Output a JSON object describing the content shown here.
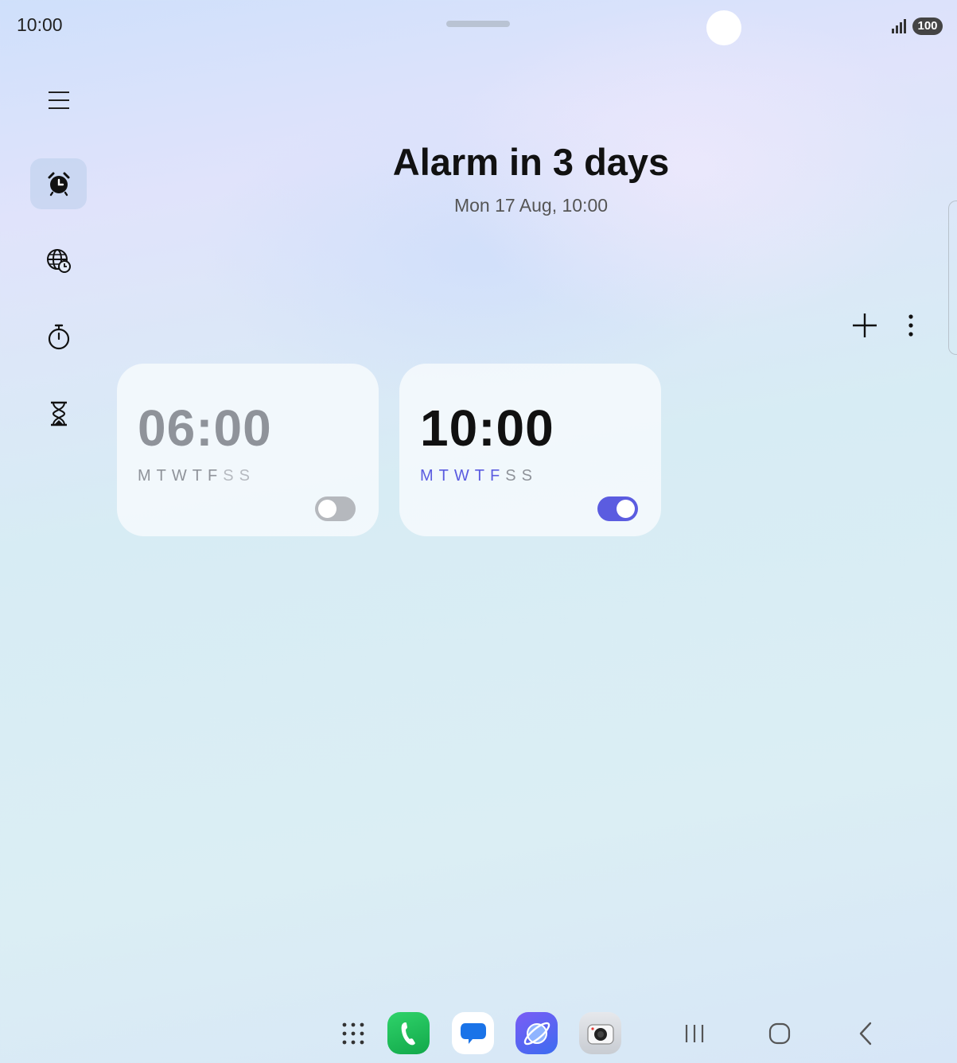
{
  "status_bar": {
    "time": "10:00",
    "battery": "100"
  },
  "header": {
    "title": "Alarm in 3 days",
    "subtitle": "Mon 17 Aug, 10:00"
  },
  "alarms": [
    {
      "time": "06:00",
      "days": [
        "M",
        "T",
        "W",
        "T",
        "F",
        "S",
        "S"
      ],
      "enabled": false
    },
    {
      "time": "10:00",
      "days": [
        "M",
        "T",
        "W",
        "T",
        "F",
        "S",
        "S"
      ],
      "enabled": true
    }
  ],
  "colors": {
    "accent": "#5b5ce0",
    "toggle_off": "#b5b8bd",
    "dim_text": "#8f939a",
    "weekend_dim": "#b6bac0"
  },
  "icons": [
    "menu-icon",
    "alarm-icon",
    "world-clock-icon",
    "stopwatch-icon",
    "timer-icon",
    "add-icon",
    "more-options-icon",
    "apps-grid-icon",
    "phone-icon",
    "messages-icon",
    "internet-icon",
    "camera-icon",
    "recents-icon",
    "home-icon",
    "back-icon"
  ]
}
